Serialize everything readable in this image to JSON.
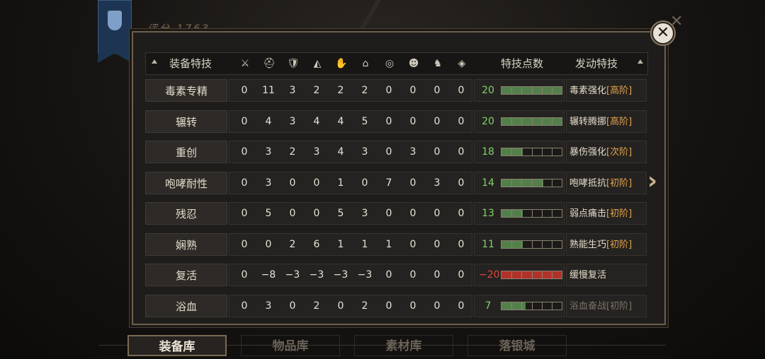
{
  "hud": {
    "score": "评分 1763"
  },
  "headers": {
    "name": "装备特技",
    "points": "特技点数",
    "skill": "发动特技"
  },
  "icons": [
    "sword-icon",
    "helmet-icon",
    "chest-armor-icon",
    "shoulder-icon",
    "glove-icon",
    "boots-icon",
    "ring-icon",
    "mask-icon",
    "horse-icon",
    "amulet-icon"
  ],
  "icon_glyphs": [
    "⚔",
    "⛑",
    "🛡",
    "◭",
    "✋",
    "⌂",
    "◎",
    "☻",
    "♞",
    "◈"
  ],
  "rows": [
    {
      "name": "毒素专精",
      "values": [
        "0",
        "11",
        "3",
        "2",
        "2",
        "2",
        "0",
        "0",
        "0",
        "0"
      ],
      "points": "20",
      "fill": 1.0,
      "skill": "毒素强化",
      "tier": "[高阶]"
    },
    {
      "name": "辗转",
      "values": [
        "0",
        "4",
        "3",
        "4",
        "4",
        "5",
        "0",
        "0",
        "0",
        "0"
      ],
      "points": "20",
      "fill": 1.0,
      "skill": "辗转腾挪",
      "tier": "[高阶]"
    },
    {
      "name": "重创",
      "values": [
        "0",
        "3",
        "2",
        "3",
        "4",
        "3",
        "0",
        "3",
        "0",
        "0"
      ],
      "points": "18",
      "fill": 0.35,
      "skill": "暴伤强化",
      "tier": "[次阶]"
    },
    {
      "name": "咆哮耐性",
      "values": [
        "0",
        "3",
        "0",
        "0",
        "1",
        "0",
        "7",
        "0",
        "3",
        "0"
      ],
      "points": "14",
      "fill": 0.7,
      "skill": "咆哮抵抗",
      "tier": "[初阶]"
    },
    {
      "name": "残忍",
      "values": [
        "0",
        "5",
        "0",
        "0",
        "5",
        "3",
        "0",
        "0",
        "0",
        "0"
      ],
      "points": "13",
      "fill": 0.35,
      "skill": "弱点痛击",
      "tier": "[初阶]"
    },
    {
      "name": "娴熟",
      "values": [
        "0",
        "0",
        "2",
        "6",
        "1",
        "1",
        "1",
        "0",
        "0",
        "0"
      ],
      "points": "11",
      "fill": 0.35,
      "skill": "熟能生巧",
      "tier": "[初阶]"
    },
    {
      "name": "复活",
      "values": [
        "0",
        "−8",
        "−3",
        "−3",
        "−3",
        "−3",
        "0",
        "0",
        "0",
        "0"
      ],
      "points": "−20",
      "fill": 1.0,
      "negative": true,
      "skill": "缓慢复活",
      "tier": ""
    },
    {
      "name": "浴血",
      "values": [
        "0",
        "3",
        "0",
        "2",
        "0",
        "2",
        "0",
        "0",
        "0",
        "0"
      ],
      "points": "7",
      "fill": 0.4,
      "skill": "浴血奋战",
      "tier": "[初阶]",
      "dim": true
    }
  ],
  "tabs": [
    {
      "label": "装备库",
      "active": true
    },
    {
      "label": "物品库",
      "active": false
    },
    {
      "label": "素材库",
      "active": false
    },
    {
      "label": "落银城",
      "active": false
    }
  ]
}
